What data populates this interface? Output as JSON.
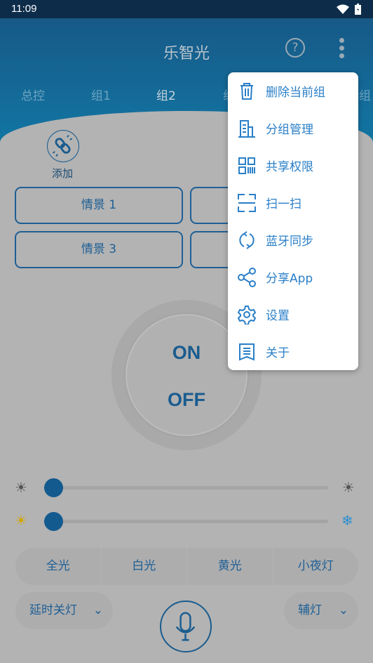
{
  "status_bar": {
    "time": "11:09"
  },
  "header": {
    "title": "乐智光",
    "help_icon": "question-circle-icon",
    "more_icon": "more-vert-icon"
  },
  "tabs": [
    {
      "label": "总控"
    },
    {
      "label": "组1"
    },
    {
      "label": "组2",
      "active": true
    },
    {
      "label": "组"
    },
    {
      "label": "组"
    }
  ],
  "add": {
    "label": "添加",
    "icon": "link-add-icon"
  },
  "scenes": [
    {
      "label": "情景 1"
    },
    {
      "label": ""
    },
    {
      "label": "情景 3"
    },
    {
      "label": ""
    }
  ],
  "power": {
    "on_label": "ON",
    "off_label": "OFF"
  },
  "sliders": {
    "brightness_percent": 0,
    "color_temp_percent": 0
  },
  "modes": [
    {
      "label": "全光"
    },
    {
      "label": "白光"
    },
    {
      "label": "黄光"
    },
    {
      "label": "小夜灯"
    }
  ],
  "bottom": {
    "timer_label": "延时关灯",
    "aux_label": "辅灯"
  },
  "menu": {
    "items": [
      {
        "label": "删除当前组",
        "icon": "trash-icon"
      },
      {
        "label": "分组管理",
        "icon": "building-icon"
      },
      {
        "label": "共享权限",
        "icon": "qr-code-icon"
      },
      {
        "label": "扫一扫",
        "icon": "scan-icon"
      },
      {
        "label": "蓝牙同步",
        "icon": "sync-icon"
      },
      {
        "label": "分享App",
        "icon": "share-icon"
      },
      {
        "label": "设置",
        "icon": "gear-icon"
      },
      {
        "label": "关于",
        "icon": "book-icon"
      }
    ]
  },
  "colors": {
    "accent": "#2a7fc8",
    "header": "#175987",
    "dim_bg": "#b3b3b3"
  }
}
